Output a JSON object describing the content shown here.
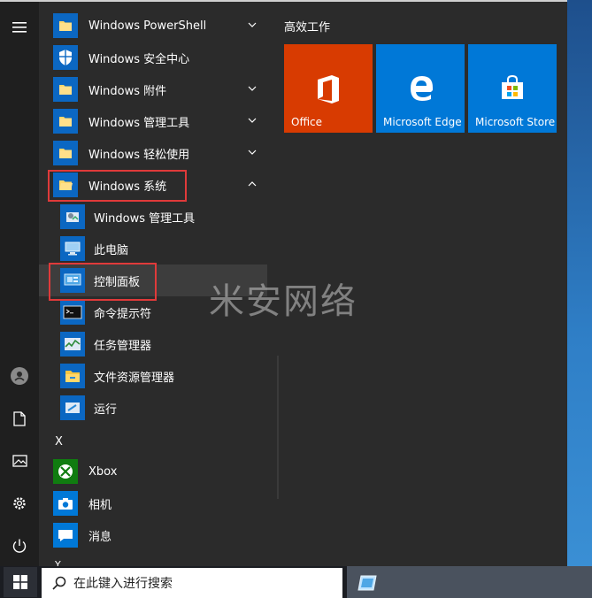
{
  "rail": {
    "items": [
      {
        "name": "hamburger-menu"
      },
      {
        "name": "user"
      },
      {
        "name": "documents"
      },
      {
        "name": "pictures"
      },
      {
        "name": "settings"
      },
      {
        "name": "power"
      }
    ]
  },
  "applist": {
    "rows": [
      {
        "label": "Windows PowerShell",
        "expandable": true,
        "icon": "folder-icon"
      },
      {
        "label": "Windows 安全中心",
        "expandable": false,
        "icon": "shield-icon"
      },
      {
        "label": "Windows 附件",
        "expandable": true,
        "icon": "folder-icon"
      },
      {
        "label": "Windows 管理工具",
        "expandable": true,
        "icon": "folder-icon"
      },
      {
        "label": "Windows 轻松使用",
        "expandable": true,
        "icon": "folder-icon"
      },
      {
        "label": "Windows 系统",
        "expandable": true,
        "expanded": true,
        "icon": "folder-icon"
      }
    ],
    "sub_rows": [
      {
        "label": "Windows 管理工具",
        "icon": "admin-tools-icon"
      },
      {
        "label": "此电脑",
        "icon": "this-pc-icon"
      },
      {
        "label": "控制面板",
        "icon": "control-panel-icon",
        "hovered": true
      },
      {
        "label": "命令提示符",
        "icon": "cmd-icon"
      },
      {
        "label": "任务管理器",
        "icon": "task-manager-icon"
      },
      {
        "label": "文件资源管理器",
        "icon": "file-explorer-icon"
      },
      {
        "label": "运行",
        "icon": "run-icon"
      }
    ],
    "section_x": "X",
    "x_rows": [
      {
        "label": "Xbox",
        "icon": "xbox-icon"
      },
      {
        "label": "相机",
        "icon": "camera-icon"
      },
      {
        "label": "消息",
        "icon": "messaging-icon"
      }
    ],
    "section_y": "Y"
  },
  "tiles": {
    "group_title": "高效工作",
    "items": [
      {
        "label": "Office",
        "color": "#d83b01",
        "icon": "office-icon"
      },
      {
        "label": "Microsoft Edge",
        "color": "#0078d7",
        "icon": "edge-icon"
      },
      {
        "label": "Microsoft Store",
        "color": "#0078d7",
        "icon": "store-icon"
      }
    ]
  },
  "watermark": "米安网络",
  "taskbar": {
    "search_placeholder": "在此键入进行搜索"
  },
  "colors": {
    "highlight_box": "#e03a3a",
    "accent": "#0078d7"
  }
}
